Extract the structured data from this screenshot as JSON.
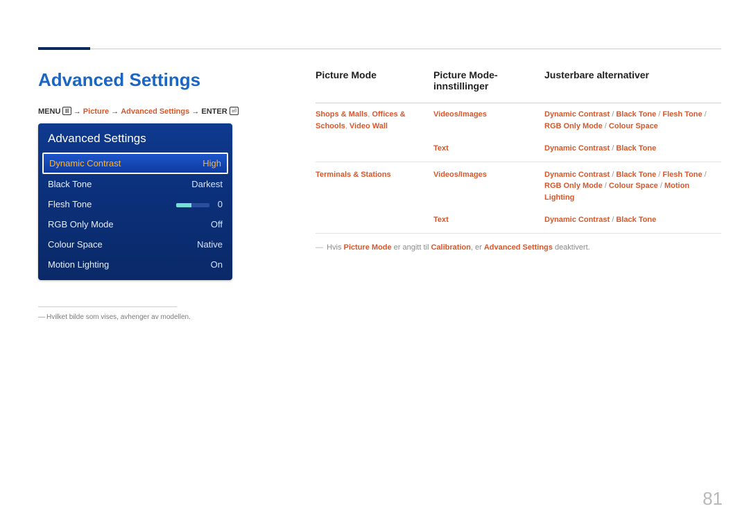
{
  "page": {
    "title": "Advanced Settings",
    "number": "81"
  },
  "breadcrumb": {
    "menu": "MENU",
    "arrow": "→",
    "picture": "Picture",
    "advanced": "Advanced Settings",
    "enter": "ENTER"
  },
  "osd": {
    "title": "Advanced Settings",
    "rows": [
      {
        "label": "Dynamic Contrast",
        "value": "High"
      },
      {
        "label": "Black Tone",
        "value": "Darkest"
      },
      {
        "label": "Flesh Tone",
        "value": "0",
        "slider": true
      },
      {
        "label": "RGB Only Mode",
        "value": "Off"
      },
      {
        "label": "Colour Space",
        "value": "Native"
      },
      {
        "label": "Motion Lighting",
        "value": "On"
      }
    ]
  },
  "footnote": "Hvilket bilde som vises, avhenger av modellen.",
  "table": {
    "headers": {
      "c1": "Picture Mode",
      "c2": "Picture Mode-innstillinger",
      "c3": "Justerbare alternativer"
    },
    "rows": [
      {
        "c1": "Shops & Malls, Offices & Schools, Video Wall",
        "c2": "Videos/Images",
        "c3": "Dynamic Contrast / Black Tone / Flesh Tone / RGB Only Mode / Colour Space"
      },
      {
        "c1": "",
        "c2": "Text",
        "c3": "Dynamic Contrast / Black Tone"
      },
      {
        "c1": "Terminals & Stations",
        "c2": "Videos/Images",
        "c3": "Dynamic Contrast / Black Tone / Flesh Tone / RGB Only Mode / Colour Space / Motion Lighting"
      },
      {
        "c1": "",
        "c2": "Text",
        "c3": "Dynamic Contrast / Black Tone"
      }
    ]
  },
  "note": {
    "pre": "Hvis ",
    "b1": "Picture Mode",
    "mid": " er angitt til ",
    "b2": "Calibration",
    "mid2": ", er ",
    "b3": "Advanced Settings",
    "post": " deaktivert."
  }
}
